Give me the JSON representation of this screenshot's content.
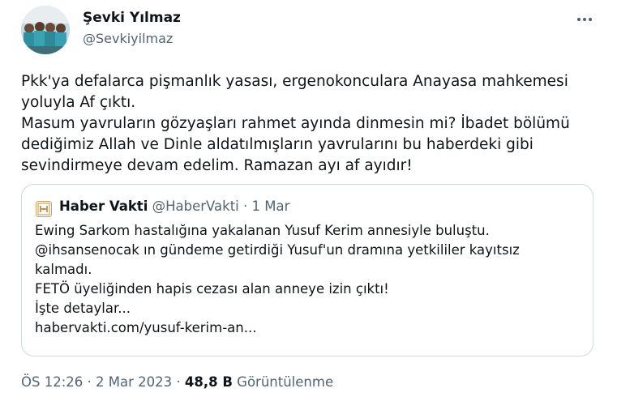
{
  "author": {
    "name": "Şevki Yılmaz",
    "handle": "@Sevkiyilmaz"
  },
  "tweet": {
    "lines": [
      "Pkk'ya defalarca pişmanlık yasası, ergenokonculara Anayasa mahkemesi",
      "yoluyla Af çıktı.",
      "Masum yavruların gözyaşları rahmet ayında dinmesin mi? İbadet bölümü",
      "dediğimiz Allah ve Dinle aldatılmışların yavrularını bu haberdeki gibi",
      "sevindirmeye devam edelim. Ramazan ayı af ayıdır!"
    ]
  },
  "quote": {
    "name": "Haber Vakti",
    "handle": "@HaberVakti",
    "separator": "·",
    "date": "1 Mar",
    "lines": [
      "Ewing Sarkom hastalığına yakalanan Yusuf Kerim annesiyle buluştu.",
      "@ihsansenocak ın gündeme getirdiği Yusuf'un dramına yetkililer kayıtsız",
      "kalmadı.",
      "FETÖ üyeliğinden hapis cezası alan anneye izin çıktı!",
      "İşte detaylar...",
      "habervakti.com/yusuf-kerim-an..."
    ]
  },
  "footer": {
    "time": "ÖS 12:26",
    "separator1": "·",
    "date": "2 Mar 2023",
    "separator2": "·",
    "views": "48,8 B",
    "views_label": "Görüntülenme"
  },
  "icons": {
    "more": "more-horizontal-icon",
    "quote_logo": "haber-vakti-logo"
  },
  "colors": {
    "text_primary": "#0f1419",
    "text_secondary": "#536471",
    "border": "#cfd9de"
  }
}
